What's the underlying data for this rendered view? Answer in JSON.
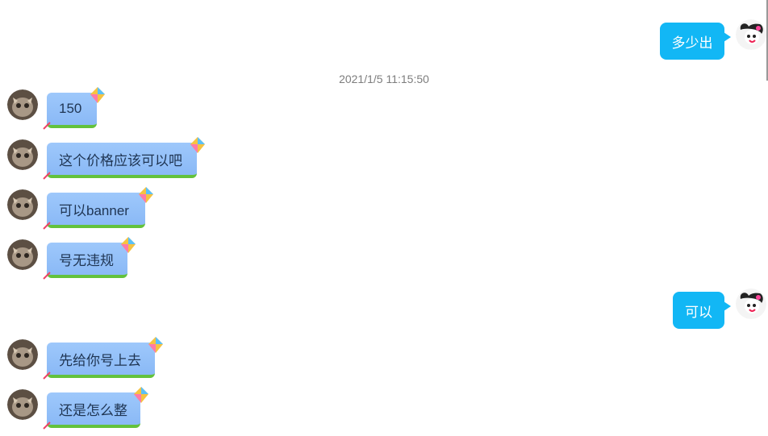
{
  "timestamp": "2021/1/5 11:15:50",
  "messages": [
    {
      "side": "out",
      "text": "多少出"
    },
    {
      "side": "in",
      "text": "150"
    },
    {
      "side": "in",
      "text": "这个价格应该可以吧"
    },
    {
      "side": "in",
      "text": "可以banner"
    },
    {
      "side": "in",
      "text": "号无违规"
    },
    {
      "side": "out",
      "text": "可以"
    },
    {
      "side": "in",
      "text": "先给你号上去"
    },
    {
      "side": "in",
      "text": "还是怎么整"
    }
  ],
  "colors": {
    "outgoing_bubble": "#12b7f5",
    "incoming_bubble": "#8ab9f6",
    "incoming_border": "#63c23c"
  },
  "icons": {
    "outgoing_avatar": "kuromi-avatar",
    "incoming_avatar": "cat-avatar",
    "bubble_decoration": "kite-icon"
  }
}
